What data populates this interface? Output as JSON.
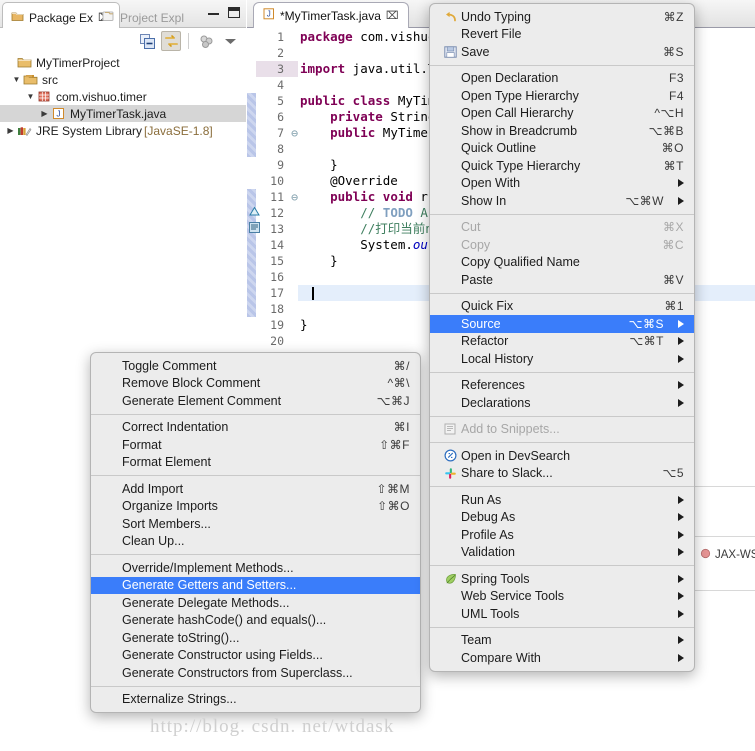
{
  "explorer": {
    "tabs": [
      {
        "label": "Package Ex",
        "icon": "package-icon",
        "active": true,
        "close": "⌧"
      },
      {
        "label": "Project Expl",
        "icon": "project-icon",
        "active": false
      }
    ],
    "toolbar": [
      {
        "icon": "collapse-all-icon"
      },
      {
        "icon": "link-with-editor-icon"
      },
      {
        "icon": "focus-icon"
      },
      {
        "icon": "view-menu-icon"
      }
    ],
    "tree": [
      {
        "label": "MyTimerProject",
        "indent": 0,
        "arrow": "",
        "icon": "project-folder-icon",
        "selected": false,
        "suffix": ""
      },
      {
        "label": "src",
        "indent": 1,
        "arrow": "▼",
        "icon": "source-folder-icon",
        "selected": false,
        "suffix": ""
      },
      {
        "label": "com.vishuo.timer",
        "indent": 2,
        "arrow": "▼",
        "icon": "package-icon",
        "selected": false,
        "suffix": ""
      },
      {
        "label": "MyTimerTask.java",
        "indent": 3,
        "arrow": "▶",
        "icon": "java-file-icon",
        "selected": true,
        "suffix": ""
      },
      {
        "label": "JRE System Library",
        "indent": 1,
        "arrow": "▶",
        "icon": "library-icon",
        "selected": false,
        "suffix": "[JavaSE-1.8]"
      }
    ]
  },
  "editor": {
    "tab": {
      "label": "*MyTimerTask.java",
      "icon": "java-file-icon",
      "close": "⌧"
    },
    "lines": [
      {
        "n": "1",
        "fold": "",
        "marker": "",
        "text": "package com.vishuo."
      },
      {
        "n": "2",
        "fold": "",
        "marker": "",
        "text": ""
      },
      {
        "n": "3",
        "fold": "",
        "marker": "",
        "text": "import java.util.Ti"
      },
      {
        "n": "4",
        "fold": "",
        "marker": "",
        "text": ""
      },
      {
        "n": "5",
        "fold": "",
        "marker": "",
        "text": "public class MyTime"
      },
      {
        "n": "6",
        "fold": "",
        "marker": "",
        "text": "    private String"
      },
      {
        "n": "7",
        "fold": "⊖",
        "marker": "",
        "text": "    public MyTimerT"
      },
      {
        "n": "8",
        "fold": "",
        "marker": "",
        "text": ""
      },
      {
        "n": "9",
        "fold": "",
        "marker": "",
        "text": "    }"
      },
      {
        "n": "10",
        "fold": "⊖",
        "marker": "",
        "text": "    @Override"
      },
      {
        "n": "11",
        "fold": "",
        "marker": "override",
        "text": "    public void run"
      },
      {
        "n": "12",
        "fold": "",
        "marker": "todo",
        "text": "        // TODO Aut"
      },
      {
        "n": "13",
        "fold": "",
        "marker": "",
        "text": "        //打印当前na"
      },
      {
        "n": "14",
        "fold": "",
        "marker": "",
        "text": "        System.out."
      },
      {
        "n": "15",
        "fold": "",
        "marker": "",
        "text": "    }"
      },
      {
        "n": "16",
        "fold": "",
        "marker": "",
        "text": ""
      },
      {
        "n": "17",
        "fold": "",
        "marker": "",
        "text": ""
      },
      {
        "n": "18",
        "fold": "",
        "marker": "",
        "text": ""
      },
      {
        "n": "19",
        "fold": "",
        "marker": "",
        "text": "}"
      },
      {
        "n": "20",
        "fold": "",
        "marker": "",
        "text": ""
      }
    ]
  },
  "source_menu": {
    "name": "Source",
    "groups": [
      [
        {
          "label": "Toggle Comment",
          "key": "⌘/",
          "icon": "",
          "sub": false
        },
        {
          "label": "Remove Block Comment",
          "key": "^⌘\\",
          "icon": "",
          "sub": false
        },
        {
          "label": "Generate Element Comment",
          "key": "⌥⌘J",
          "icon": "",
          "sub": false
        }
      ],
      [
        {
          "label": "Correct Indentation",
          "key": "⌘I",
          "icon": "",
          "sub": false
        },
        {
          "label": "Format",
          "key": "⇧⌘F",
          "icon": "",
          "sub": false
        },
        {
          "label": "Format Element",
          "key": "",
          "icon": "",
          "sub": false
        }
      ],
      [
        {
          "label": "Add Import",
          "key": "⇧⌘M",
          "icon": "",
          "sub": false
        },
        {
          "label": "Organize Imports",
          "key": "⇧⌘O",
          "icon": "",
          "sub": false
        },
        {
          "label": "Sort Members...",
          "key": "",
          "icon": "",
          "sub": false
        },
        {
          "label": "Clean Up...",
          "key": "",
          "icon": "",
          "sub": false
        }
      ],
      [
        {
          "label": "Override/Implement Methods...",
          "key": "",
          "icon": "",
          "sub": false
        },
        {
          "label": "Generate Getters and Setters...",
          "key": "",
          "icon": "",
          "sub": false,
          "highlighted": true
        },
        {
          "label": "Generate Delegate Methods...",
          "key": "",
          "icon": "",
          "sub": false
        },
        {
          "label": "Generate hashCode() and equals()...",
          "key": "",
          "icon": "",
          "sub": false
        },
        {
          "label": "Generate toString()...",
          "key": "",
          "icon": "",
          "sub": false
        },
        {
          "label": "Generate Constructor using Fields...",
          "key": "",
          "icon": "",
          "sub": false
        },
        {
          "label": "Generate Constructors from Superclass...",
          "key": "",
          "icon": "",
          "sub": false
        }
      ],
      [
        {
          "label": "Externalize Strings...",
          "key": "",
          "icon": "",
          "sub": false
        }
      ]
    ]
  },
  "main_menu": {
    "groups": [
      [
        {
          "label": "Undo Typing",
          "key": "⌘Z",
          "icon": "undo-icon",
          "sub": false
        },
        {
          "label": "Revert File",
          "key": "",
          "icon": "",
          "sub": false
        },
        {
          "label": "Save",
          "key": "⌘S",
          "icon": "save-icon",
          "sub": false
        }
      ],
      [
        {
          "label": "Open Declaration",
          "key": "F3",
          "icon": "",
          "sub": false
        },
        {
          "label": "Open Type Hierarchy",
          "key": "F4",
          "icon": "",
          "sub": false
        },
        {
          "label": "Open Call Hierarchy",
          "key": "^⌥H",
          "icon": "",
          "sub": false
        },
        {
          "label": "Show in Breadcrumb",
          "key": "⌥⌘B",
          "icon": "",
          "sub": false
        },
        {
          "label": "Quick Outline",
          "key": "⌘O",
          "icon": "",
          "sub": false
        },
        {
          "label": "Quick Type Hierarchy",
          "key": "⌘T",
          "icon": "",
          "sub": false
        },
        {
          "label": "Open With",
          "key": "",
          "icon": "",
          "sub": true
        },
        {
          "label": "Show In",
          "key": "⌥⌘W",
          "icon": "",
          "sub": true
        }
      ],
      [
        {
          "label": "Cut",
          "key": "⌘X",
          "icon": "",
          "sub": false,
          "disabled": true
        },
        {
          "label": "Copy",
          "key": "⌘C",
          "icon": "",
          "sub": false,
          "disabled": true
        },
        {
          "label": "Copy Qualified Name",
          "key": "",
          "icon": "",
          "sub": false
        },
        {
          "label": "Paste",
          "key": "⌘V",
          "icon": "",
          "sub": false
        }
      ],
      [
        {
          "label": "Quick Fix",
          "key": "⌘1",
          "icon": "",
          "sub": false
        },
        {
          "label": "Source",
          "key": "⌥⌘S",
          "icon": "",
          "sub": true,
          "highlighted": true
        },
        {
          "label": "Refactor",
          "key": "⌥⌘T",
          "icon": "",
          "sub": true
        },
        {
          "label": "Local History",
          "key": "",
          "icon": "",
          "sub": true
        }
      ],
      [
        {
          "label": "References",
          "key": "",
          "icon": "",
          "sub": true
        },
        {
          "label": "Declarations",
          "key": "",
          "icon": "",
          "sub": true
        }
      ],
      [
        {
          "label": "Add to Snippets...",
          "key": "",
          "icon": "snippets-icon",
          "sub": false,
          "disabled": true
        }
      ],
      [
        {
          "label": "Open in DevSearch",
          "key": "",
          "icon": "devsearch-icon",
          "sub": false
        },
        {
          "label": "Share to Slack...",
          "key": "⌥5",
          "icon": "slack-icon",
          "sub": false
        }
      ],
      [
        {
          "label": "Run As",
          "key": "",
          "icon": "",
          "sub": true
        },
        {
          "label": "Debug As",
          "key": "",
          "icon": "",
          "sub": true
        },
        {
          "label": "Profile As",
          "key": "",
          "icon": "",
          "sub": true
        },
        {
          "label": "Validation",
          "key": "",
          "icon": "",
          "sub": true
        }
      ],
      [
        {
          "label": "Spring Tools",
          "key": "",
          "icon": "spring-leaf-icon",
          "sub": true
        },
        {
          "label": "Web Service Tools",
          "key": "",
          "icon": "",
          "sub": true
        },
        {
          "label": "UML Tools",
          "key": "",
          "icon": "",
          "sub": true
        }
      ],
      [
        {
          "label": "Team",
          "key": "",
          "icon": "",
          "sub": true
        },
        {
          "label": "Compare With",
          "key": "",
          "icon": "",
          "sub": true
        }
      ]
    ]
  },
  "background": {
    "jaxws_label": "JAX-WS A"
  },
  "watermark": {
    "text": "http://blog. csdn. net/wtdask"
  },
  "colors": {
    "highlight": "#3a7dfa",
    "menu_bg": "#ececec",
    "tree_selection": "#d6d6d6",
    "caret_line": "#e4eefb"
  }
}
